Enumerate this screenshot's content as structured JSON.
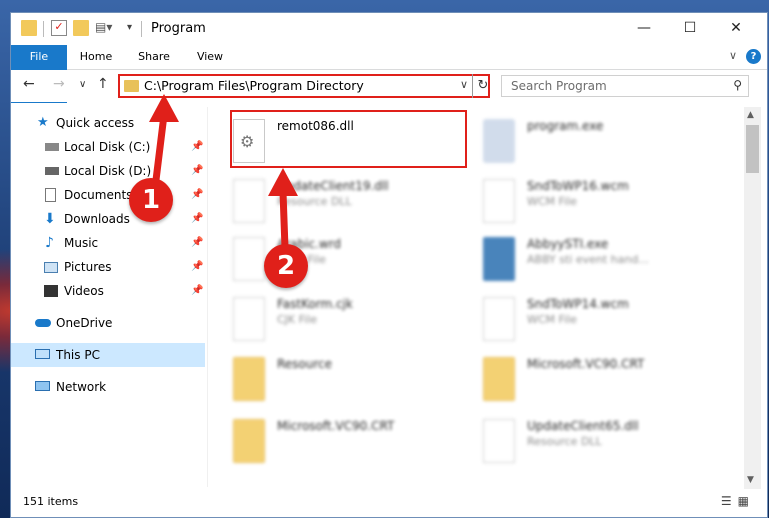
{
  "window": {
    "title": "Program"
  },
  "ribbon": {
    "tabs": [
      "File",
      "Home",
      "Share",
      "View"
    ]
  },
  "nav": {
    "address": "C:\\Program Files\\Program Directory",
    "search_placeholder": "Search Program"
  },
  "sidebar": {
    "items": [
      {
        "label": "Quick access"
      },
      {
        "label": "Local Disk (C:)"
      },
      {
        "label": "Local Disk (D:)"
      },
      {
        "label": "Documents"
      },
      {
        "label": "Downloads"
      },
      {
        "label": "Music"
      },
      {
        "label": "Pictures"
      },
      {
        "label": "Videos"
      },
      {
        "label": "OneDrive"
      },
      {
        "label": "This PC"
      },
      {
        "label": "Network"
      }
    ]
  },
  "files": [
    {
      "name": "remot086.dll",
      "type": ""
    },
    {
      "name": "program.exe",
      "type": ""
    },
    {
      "name": "UpdateClient19.dll",
      "type": "Resource DLL"
    },
    {
      "name": "SndToWP16.wcm",
      "type": "WCM File"
    },
    {
      "name": "Arabic.wrd",
      "type": "WRD File"
    },
    {
      "name": "AbbyySTI.exe",
      "type": "ABBY sti event hand..."
    },
    {
      "name": "FastKorm.cjk",
      "type": "CJK File"
    },
    {
      "name": "SndToWP14.wcm",
      "type": "WCM File"
    },
    {
      "name": "Resource",
      "type": ""
    },
    {
      "name": "Microsoft.VC90.CRT",
      "type": ""
    },
    {
      "name": "Microsoft.VC90.CRT",
      "type": ""
    },
    {
      "name": "UpdateClient65.dll",
      "type": "Resource DLL"
    }
  ],
  "status": {
    "item_count": "151 items"
  },
  "annotations": {
    "step1": "1",
    "step2": "2"
  },
  "colors": {
    "accent": "#1979ca",
    "highlight": "#e0201a",
    "selection": "#cce8ff"
  }
}
